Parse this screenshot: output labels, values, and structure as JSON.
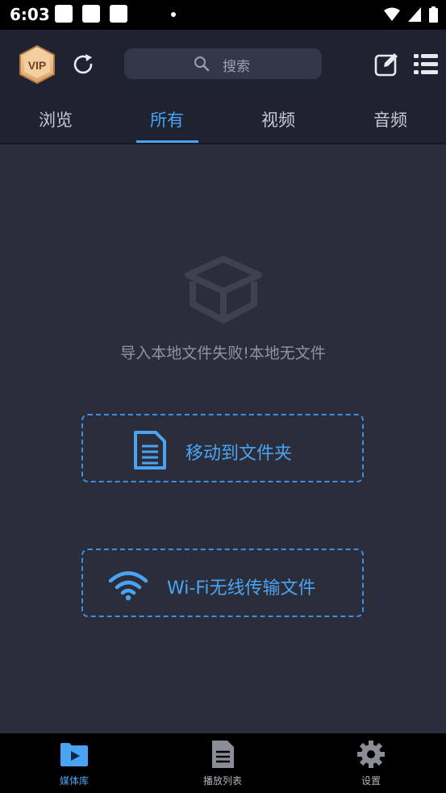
{
  "status_bar": {
    "time": "6:03"
  },
  "header": {
    "vip_label": "VIP",
    "search_placeholder": "搜索"
  },
  "tabs": [
    {
      "label": "浏览",
      "active": false
    },
    {
      "label": "所有",
      "active": true
    },
    {
      "label": "视频",
      "active": false
    },
    {
      "label": "音频",
      "active": false
    }
  ],
  "empty_state": {
    "message": "导入本地文件失败!本地无文件"
  },
  "actions": {
    "move_to_folder": "移动到文件夹",
    "wifi_transfer": "Wi-Fi无线传输文件"
  },
  "bottom_nav": [
    {
      "label": "媒体库",
      "icon": "media-library-icon",
      "active": true
    },
    {
      "label": "播放列表",
      "icon": "playlist-icon",
      "active": false
    },
    {
      "label": "设置",
      "icon": "gear-icon",
      "active": false
    }
  ],
  "colors": {
    "accent": "#4aa3f3",
    "background": "#2b2e3a",
    "header": "#1f2230"
  }
}
